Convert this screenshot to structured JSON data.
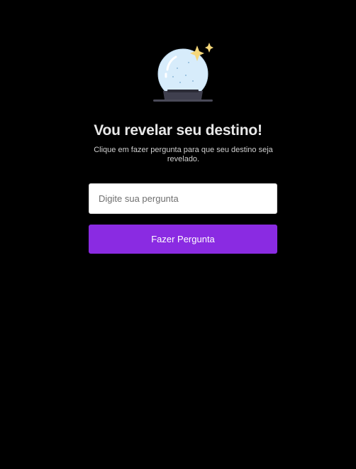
{
  "hero": {
    "illustration_icon": "crystal-ball-icon",
    "title": "Vou revelar seu destino!",
    "subtitle": "Clique em fazer pergunta para que seu destino seja revelado."
  },
  "form": {
    "question_placeholder": "Digite sua pergunta",
    "question_value": "",
    "submit_label": "Fazer Pergunta"
  },
  "colors": {
    "background": "#000000",
    "accent": "#8a2be2",
    "title_text": "#e8e8e8",
    "sparkle": "#f5d77a",
    "orb": "#d7ecfb"
  }
}
